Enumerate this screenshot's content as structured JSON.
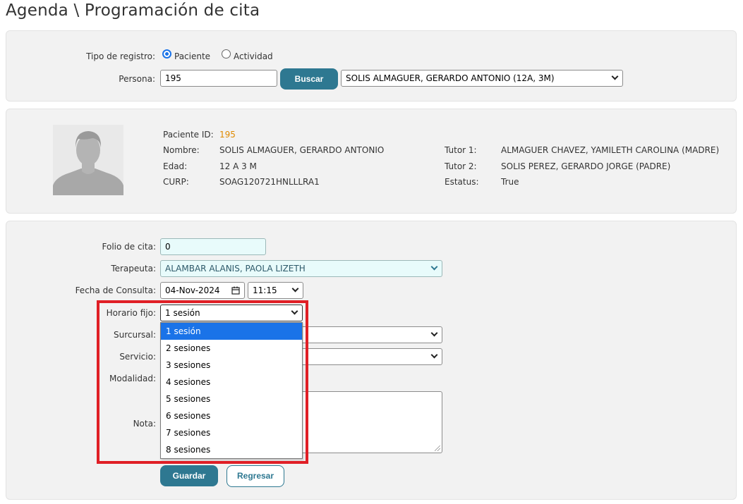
{
  "page": {
    "title": "Agenda \\ Programación de cita"
  },
  "search": {
    "tipo_label": "Tipo de registro:",
    "options": [
      {
        "label": "Paciente",
        "selected": true
      },
      {
        "label": "Actividad",
        "selected": false
      }
    ],
    "persona_label": "Persona:",
    "persona_value": "195",
    "buscar_label": "Buscar",
    "persona_select": "SOLIS ALMAGUER, GERARDO ANTONIO (12A, 3M)"
  },
  "patient": {
    "avatar_icon": "user-silhouette-icon",
    "fields": [
      {
        "label": "Paciente ID:",
        "value": "195"
      },
      {
        "label": "Nombre:",
        "value": "SOLIS ALMAGUER, GERARDO ANTONIO"
      },
      {
        "label": "Edad:",
        "value": "12 A 3 M"
      },
      {
        "label": "CURP:",
        "value": "SOAG120721HNLLLRA1"
      }
    ],
    "right_fields": [
      {
        "label": "Tutor 1:",
        "value": "ALMAGUER CHAVEZ, YAMILETH CAROLINA (MADRE)"
      },
      {
        "label": "Tutor 2:",
        "value": "SOLIS PEREZ, GERARDO JORGE (PADRE)"
      },
      {
        "label": "Estatus:",
        "value": "True"
      }
    ],
    "id_color": "#e08a00"
  },
  "form": {
    "folio_label": "Folio de cita:",
    "folio_value": "0",
    "terapeuta_label": "Terapeuta:",
    "terapeuta_value": "ALAMBAR ALANIS, PAOLA LIZETH",
    "fecha_label": "Fecha de Consulta:",
    "fecha_value": "04-Nov-2024",
    "hora_value": "11:15",
    "horario_label": "Horario fijo:",
    "horario_value": "1 sesión",
    "horario_options": [
      "1 sesión",
      "2 sesiones",
      "3 sesiones",
      "4 sesiones",
      "5 sesiones",
      "6 sesiones",
      "7 sesiones",
      "8 sesiones"
    ],
    "sucursal_label": "Surcursal:",
    "servicio_label": "Servicio:",
    "modalidad_label": "Modalidad:",
    "nota_label": "Nota:",
    "guardar_label": "Guardar",
    "regresar_label": "Regresar"
  },
  "colors": {
    "primary": "#2e7891",
    "panel_bg": "#f2f2f2",
    "highlight": "#e01f26",
    "option_selected": "#1a73e8"
  }
}
